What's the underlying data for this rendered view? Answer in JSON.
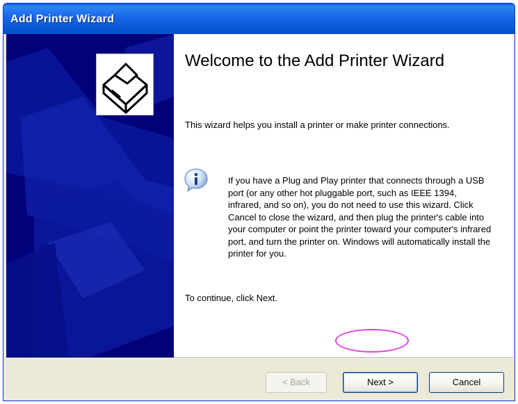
{
  "window": {
    "title": "Add Printer Wizard"
  },
  "content": {
    "heading": "Welcome to the Add Printer Wizard",
    "intro": "This wizard helps you install a printer or make printer connections.",
    "info": "If you have a Plug and Play printer that connects through a USB port (or any other hot pluggable port, such as IEEE 1394, infrared, and so on), you do not need to use this wizard. Click Cancel to close the wizard, and then plug the printer's cable into your computer or point the printer toward your computer's infrared port, and turn the printer on. Windows will automatically install the printer for you.",
    "continue": "To continue, click Next."
  },
  "buttons": {
    "back": "< Back",
    "next": "Next >",
    "cancel": "Cancel"
  },
  "icons": {
    "wizard": "printer-icon",
    "info": "info-icon"
  },
  "colors": {
    "titlebar": "#0a58d6",
    "side_panel": "#01027a",
    "highlight": "#e040e0"
  }
}
